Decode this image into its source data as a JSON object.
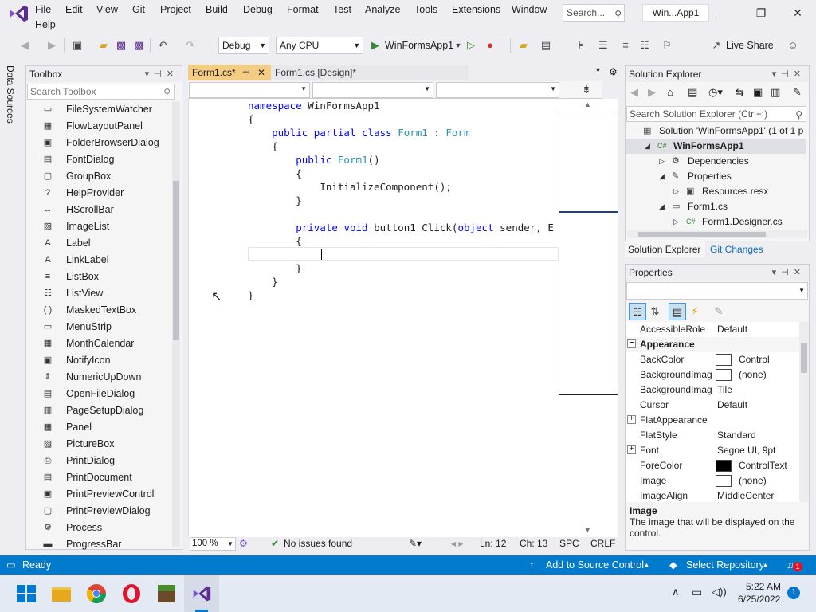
{
  "menu": {
    "items": [
      "File",
      "Edit",
      "View",
      "Git",
      "Project",
      "Build",
      "Debug",
      "Format",
      "Test",
      "Analyze",
      "Tools",
      "Extensions",
      "Window",
      "Help"
    ],
    "search_placeholder": "Search...",
    "solution_name": "Win...App1"
  },
  "toolbar": {
    "config": "Debug",
    "platform": "Any CPU",
    "start_label": "WinFormsApp1",
    "live_share": "Live Share"
  },
  "left_tab": "Data Sources",
  "toolbox": {
    "title": "Toolbox",
    "search_placeholder": "Search Toolbox",
    "items": [
      {
        "label": "FileSystemWatcher",
        "icon": "file-watcher-icon",
        "glyph": "▭"
      },
      {
        "label": "FlowLayoutPanel",
        "icon": "flow-layout-icon",
        "glyph": "▦"
      },
      {
        "label": "FolderBrowserDialog",
        "icon": "folder-browser-icon",
        "glyph": "▣"
      },
      {
        "label": "FontDialog",
        "icon": "font-dialog-icon",
        "glyph": "▤"
      },
      {
        "label": "GroupBox",
        "icon": "group-box-icon",
        "glyph": "▢"
      },
      {
        "label": "HelpProvider",
        "icon": "help-provider-icon",
        "glyph": "?"
      },
      {
        "label": "HScrollBar",
        "icon": "hscrollbar-icon",
        "glyph": "↔"
      },
      {
        "label": "ImageList",
        "icon": "image-list-icon",
        "glyph": "▨"
      },
      {
        "label": "Label",
        "icon": "label-icon",
        "glyph": "A"
      },
      {
        "label": "LinkLabel",
        "icon": "link-label-icon",
        "glyph": "A"
      },
      {
        "label": "ListBox",
        "icon": "list-box-icon",
        "glyph": "≡"
      },
      {
        "label": "ListView",
        "icon": "list-view-icon",
        "glyph": "☷"
      },
      {
        "label": "MaskedTextBox",
        "icon": "masked-textbox-icon",
        "glyph": "(.)"
      },
      {
        "label": "MenuStrip",
        "icon": "menu-strip-icon",
        "glyph": "▭"
      },
      {
        "label": "MonthCalendar",
        "icon": "month-calendar-icon",
        "glyph": "▦"
      },
      {
        "label": "NotifyIcon",
        "icon": "notify-icon-icon",
        "glyph": "▣"
      },
      {
        "label": "NumericUpDown",
        "icon": "numeric-updown-icon",
        "glyph": "⇕"
      },
      {
        "label": "OpenFileDialog",
        "icon": "open-file-dialog-icon",
        "glyph": "▤"
      },
      {
        "label": "PageSetupDialog",
        "icon": "page-setup-icon",
        "glyph": "▥"
      },
      {
        "label": "Panel",
        "icon": "panel-icon",
        "glyph": "▦"
      },
      {
        "label": "PictureBox",
        "icon": "picture-box-icon",
        "glyph": "▨"
      },
      {
        "label": "PrintDialog",
        "icon": "print-dialog-icon",
        "glyph": "⎙"
      },
      {
        "label": "PrintDocument",
        "icon": "print-document-icon",
        "glyph": "▤"
      },
      {
        "label": "PrintPreviewControl",
        "icon": "print-preview-control-icon",
        "glyph": "▣"
      },
      {
        "label": "PrintPreviewDialog",
        "icon": "print-preview-dialog-icon",
        "glyph": "▢"
      },
      {
        "label": "Process",
        "icon": "process-icon",
        "glyph": "⚙"
      },
      {
        "label": "ProgressBar",
        "icon": "progress-bar-icon",
        "glyph": "▬"
      }
    ]
  },
  "editor": {
    "tabs": [
      {
        "label": "Form1.cs*"
      },
      {
        "label": "Form1.cs [Design]*"
      }
    ],
    "zoom": "100 %",
    "issues": "No issues found",
    "line": "Ln: 12",
    "col": "Ch: 13",
    "spc": "SPC",
    "eol": "CRLF"
  },
  "code_lines": [
    "namespace WinFormsApp1",
    "{",
    "    public partial class Form1 : Form",
    "    {",
    "        public Form1()",
    "        {",
    "            InitializeComponent();",
    "        }",
    "",
    "        private void button1_Click(object sender, E",
    "        {",
    "",
    "        }",
    "    }",
    "}"
  ],
  "solution_explorer": {
    "title": "Solution Explorer",
    "search_placeholder": "Search Solution Explorer (Ctrl+;)",
    "tree": [
      {
        "label": "Solution 'WinFormsApp1' (1 of 1 p",
        "level": 0
      },
      {
        "label": "WinFormsApp1",
        "level": 1
      },
      {
        "label": "Dependencies",
        "level": 2
      },
      {
        "label": "Properties",
        "level": 2
      },
      {
        "label": "Resources.resx",
        "level": 3
      },
      {
        "label": "Form1.cs",
        "level": 2
      },
      {
        "label": "Form1.Designer.cs",
        "level": 3
      }
    ],
    "tabs": [
      "Solution Explorer",
      "Git Changes"
    ]
  },
  "properties": {
    "title": "Properties",
    "rows": [
      {
        "name": "AccessibleRole",
        "value": "Default"
      },
      {
        "name": "Appearance",
        "value": "",
        "category": true
      },
      {
        "name": "BackColor",
        "value": "Control",
        "swatch": "#ffffff"
      },
      {
        "name": "BackgroundImag",
        "value": "(none)",
        "swatch": "#ffffff"
      },
      {
        "name": "BackgroundImag",
        "value": "Tile"
      },
      {
        "name": "Cursor",
        "value": "Default"
      },
      {
        "name": "FlatAppearance",
        "value": "",
        "expandable": true
      },
      {
        "name": "FlatStyle",
        "value": "Standard"
      },
      {
        "name": "Font",
        "value": "Segoe UI, 9pt",
        "expandable": true
      },
      {
        "name": "ForeColor",
        "value": "ControlText",
        "swatch": "#000000"
      },
      {
        "name": "Image",
        "value": "(none)",
        "swatch": "#ffffff"
      },
      {
        "name": "ImageAlign",
        "value": "MiddleCenter"
      }
    ],
    "desc_title": "Image",
    "desc_text": "The image that will be displayed on the control."
  },
  "statusbar": {
    "ready": "Ready",
    "source_control": "Add to Source Control",
    "repository": "Select Repository",
    "notifications": "1"
  },
  "taskbar": {
    "time": "5:22 AM",
    "date": "6/25/2022",
    "badge": "1"
  },
  "colors": {
    "accent": "#007acc",
    "active_tab": "#f5cc84",
    "vs_purple": "#68217a",
    "keyword": "#0000ff",
    "type": "#2b91af"
  }
}
